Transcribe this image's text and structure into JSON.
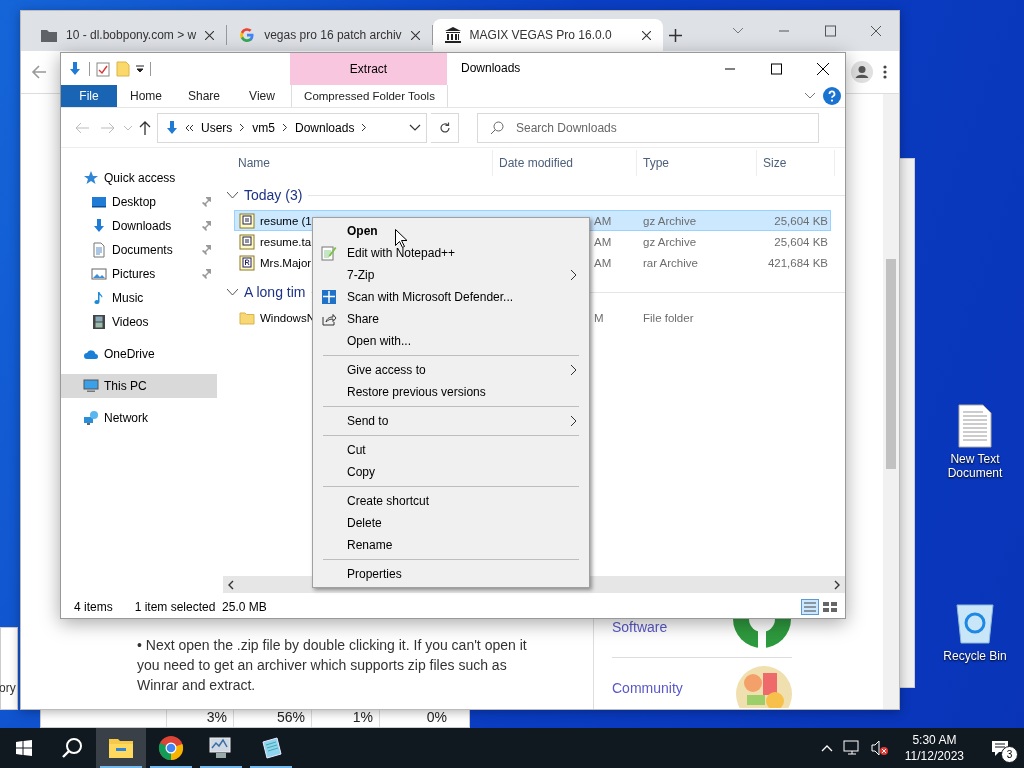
{
  "browser": {
    "tabs": [
      {
        "title": "10 - dl.bobpony.com > w",
        "kind": "folder",
        "selected": false
      },
      {
        "title": "vegas pro 16 patch archiv",
        "kind": "search",
        "selected": false
      },
      {
        "title": "MAGIX VEGAS Pro 16.0.0",
        "kind": "archive",
        "selected": true
      }
    ],
    "page": {
      "paragraph": "• Next open the .zip file by double clicking it. If you can't open it you need to get an archiver which supports zip files such as Winrar and extract.",
      "links": [
        {
          "label": "Software",
          "kind": "ring"
        },
        {
          "label": "Community",
          "kind": "collage"
        }
      ]
    }
  },
  "explorer": {
    "title": "Downloads",
    "context_group": "Extract",
    "ribbon_tabs": [
      {
        "label": "File",
        "kind": "file"
      },
      {
        "label": "Home",
        "kind": "tab"
      },
      {
        "label": "Share",
        "kind": "tab"
      },
      {
        "label": "View",
        "kind": "tab"
      },
      {
        "label": "Compressed Folder Tools",
        "kind": "context"
      }
    ],
    "address": [
      "Users",
      "vm5",
      "Downloads"
    ],
    "search": {
      "placeholder": "Search Downloads"
    },
    "sidebar": [
      {
        "label": "Quick access",
        "kind": "star",
        "pinned": false,
        "selected": false,
        "group": true
      },
      {
        "label": "Desktop",
        "kind": "desktop",
        "pinned": true,
        "selected": false,
        "group": false
      },
      {
        "label": "Downloads",
        "kind": "download",
        "pinned": true,
        "selected": false,
        "group": false
      },
      {
        "label": "Documents",
        "kind": "documents",
        "pinned": true,
        "selected": false,
        "group": false
      },
      {
        "label": "Pictures",
        "kind": "pictures",
        "pinned": true,
        "selected": false,
        "group": false
      },
      {
        "label": "Music",
        "kind": "music",
        "pinned": false,
        "selected": false,
        "group": false
      },
      {
        "label": "Videos",
        "kind": "videos",
        "pinned": false,
        "selected": false,
        "group": false
      },
      {
        "label": "OneDrive",
        "kind": "cloud",
        "pinned": false,
        "selected": false,
        "group": true
      },
      {
        "label": "This PC",
        "kind": "pc",
        "pinned": false,
        "selected": true,
        "group": true
      },
      {
        "label": "Network",
        "kind": "network",
        "pinned": false,
        "selected": false,
        "group": true
      }
    ],
    "columns": [
      "Name",
      "Date modified",
      "Type",
      "Size"
    ],
    "groups": [
      {
        "title": "Today (3)",
        "rows": [
          {
            "name": "resume (1",
            "date": "AM",
            "type": "gz Archive",
            "size": "25,604 KB",
            "kind": "gz",
            "selected": true
          },
          {
            "name": "resume.ta",
            "date": "AM",
            "type": "gz Archive",
            "size": "25,604 KB",
            "kind": "gz",
            "selected": false
          },
          {
            "name": "Mrs.Major",
            "date": "AM",
            "type": "rar Archive",
            "size": "421,684 KB",
            "kind": "rar",
            "selected": false
          }
        ]
      },
      {
        "title": "A long tim",
        "rows": [
          {
            "name": "WindowsN",
            "date": "M",
            "type": "File folder",
            "size": "",
            "kind": "folder",
            "selected": false
          }
        ]
      }
    ],
    "status": {
      "count": "4 items",
      "selection": "1 item selected  25.0 MB"
    }
  },
  "context_menu": [
    {
      "kind": "item",
      "label": "Open",
      "default": true,
      "submenu": false
    },
    {
      "kind": "notepad",
      "label": "Edit with Notepad++",
      "default": false,
      "submenu": false
    },
    {
      "kind": "item",
      "label": "7-Zip",
      "default": false,
      "submenu": true
    },
    {
      "kind": "defender",
      "label": "Scan with Microsoft Defender...",
      "default": false,
      "submenu": false
    },
    {
      "kind": "share",
      "label": "Share",
      "default": false,
      "submenu": false
    },
    {
      "kind": "item",
      "label": "Open with...",
      "default": false,
      "submenu": false
    },
    {
      "kind": "separator"
    },
    {
      "kind": "item",
      "label": "Give access to",
      "default": false,
      "submenu": true
    },
    {
      "kind": "item",
      "label": "Restore previous versions",
      "default": false,
      "submenu": false
    },
    {
      "kind": "separator"
    },
    {
      "kind": "item",
      "label": "Send to",
      "default": false,
      "submenu": true
    },
    {
      "kind": "separator"
    },
    {
      "kind": "item",
      "label": "Cut",
      "default": false,
      "submenu": false
    },
    {
      "kind": "item",
      "label": "Copy",
      "default": false,
      "submenu": false
    },
    {
      "kind": "separator"
    },
    {
      "kind": "item",
      "label": "Create shortcut",
      "default": false,
      "submenu": false
    },
    {
      "kind": "item",
      "label": "Delete",
      "default": false,
      "submenu": false
    },
    {
      "kind": "item",
      "label": "Rename",
      "default": false,
      "submenu": false
    },
    {
      "kind": "separator"
    },
    {
      "kind": "item",
      "label": "Properties",
      "default": false,
      "submenu": false
    }
  ],
  "task_manager": {
    "readings": [
      "3%",
      "56%",
      "1%",
      "0%"
    ]
  },
  "back_window": {
    "tab_label": "ory"
  },
  "desktop_icons": [
    {
      "label": "New Text Document",
      "kind": "text-file"
    },
    {
      "label": "Recycle Bin",
      "kind": "recycle-bin"
    }
  ],
  "taskbar": {
    "apps": [
      {
        "kind": "explorer",
        "active": true
      },
      {
        "kind": "chrome",
        "active": false
      },
      {
        "kind": "monitor",
        "active": false
      },
      {
        "kind": "notepad",
        "active": false
      }
    ],
    "time": "5:30 AM",
    "date": "11/12/2023",
    "notifications": "3"
  }
}
